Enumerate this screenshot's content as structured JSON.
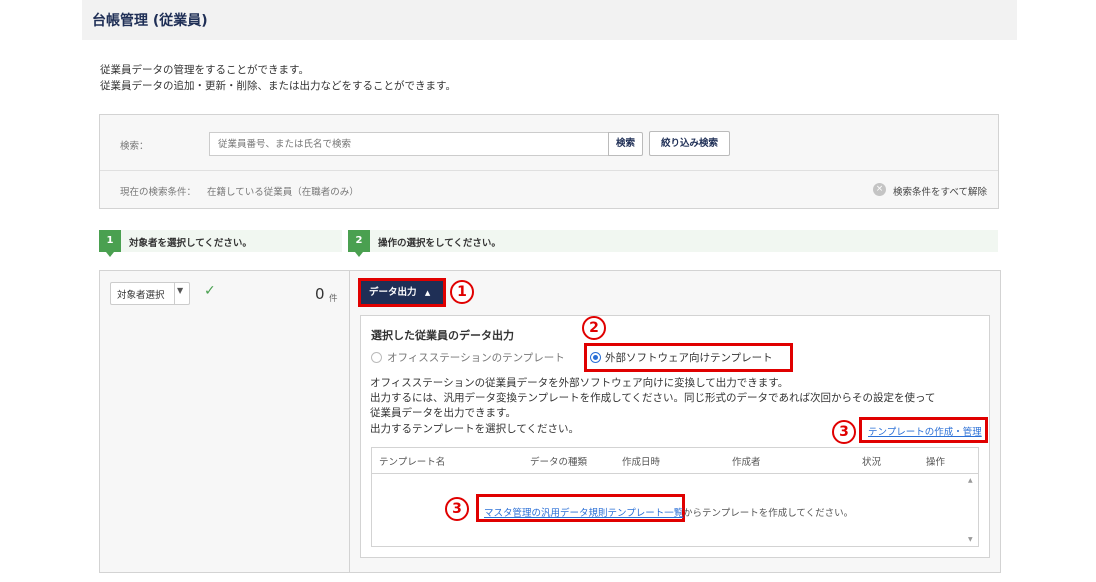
{
  "header": {
    "title": "台帳管理 (従業員)"
  },
  "description": {
    "line1": "従業員データの管理をすることができます。",
    "line2": "従業員データの追加・更新・削除、または出力などをすることができます。"
  },
  "search": {
    "label": "検索：",
    "placeholder": "従業員番号、または氏名で検索",
    "search_button": "検索",
    "narrow_button": "絞り込み検索",
    "condition_label": "現在の検索条件：",
    "condition_value": "在籍している従業員（在職者のみ）",
    "clear_all": "検索条件をすべて解除"
  },
  "steps": [
    {
      "num": "1",
      "text": "対象者を選択してください。"
    },
    {
      "num": "2",
      "text": "操作の選択をしてください。"
    }
  ],
  "target": {
    "select_label": "対象者選択",
    "count": "0",
    "count_unit": "件"
  },
  "output": {
    "button_label": "データ出力",
    "title": "選択した従業員のデータ出力",
    "radio_office": "オフィスステーションのテンプレート",
    "radio_external": "外部ソフトウェア向けテンプレート",
    "info_line1": "オフィスステーションの従業員データを外部ソフトウェア向けに変換して出力できます。",
    "info_line2": "出力するには、汎用データ変換テンプレートを作成してください。同じ形式のデータであれば次回からその設定を使って",
    "info_line3": "従業員データを出力できます。",
    "info_line4": "出力するテンプレートを選択してください。",
    "template_link": "テンプレートの作成・管理",
    "table": {
      "headers": [
        "テンプレート名",
        "データの種類",
        "作成日時",
        "作成者",
        "状況",
        "操作"
      ],
      "empty_link": "マスタ管理の汎用データ規則テンプレート一覧",
      "empty_suffix": "からテンプレートを作成してください。"
    }
  },
  "annotations": {
    "n1": "1",
    "n2": "2",
    "n3a": "3",
    "n3b": "3"
  }
}
